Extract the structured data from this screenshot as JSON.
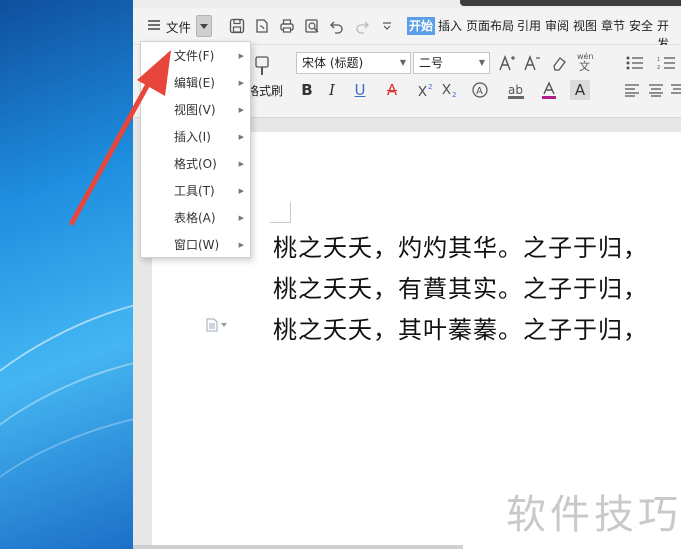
{
  "file_menu_label": "文件",
  "ribbon_tabs": [
    "开始",
    "插入",
    "页面布局",
    "引用",
    "审阅",
    "视图",
    "章节",
    "安全",
    "开发"
  ],
  "font_name": "宋体 (标题)",
  "font_size": "二号",
  "format_painter_label": "格式刷",
  "dropdown_items": [
    {
      "label": "文件(F)"
    },
    {
      "label": "编辑(E)"
    },
    {
      "label": "视图(V)"
    },
    {
      "label": "插入(I)"
    },
    {
      "label": "格式(O)"
    },
    {
      "label": "工具(T)"
    },
    {
      "label": "表格(A)"
    },
    {
      "label": "窗口(W)"
    }
  ],
  "document_lines": [
    "桃之夭夭，灼灼其华。之子于归，",
    "桃之夭夭，有蕡其实。之子于归，",
    "桃之夭夭，其叶蓁蓁。之子于归，"
  ],
  "watermark": "软件技巧",
  "colors": {
    "accent": "#5a9fe8",
    "arrow": "#e8453c",
    "font_color_bar": "#b01e8c"
  }
}
